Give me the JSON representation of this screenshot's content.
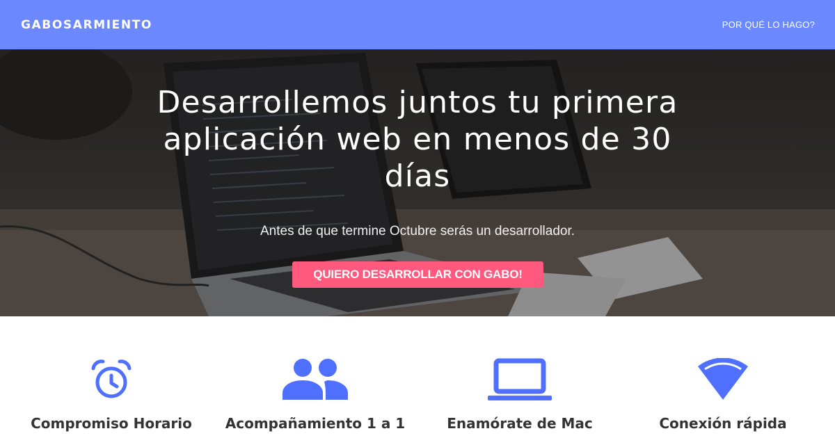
{
  "navbar": {
    "brand": "GABOSARMIENTO",
    "link": "POR QUÉ LO HAGO?",
    "background_color": "#6b88ff"
  },
  "hero": {
    "title": "Desarrollemos juntos tu primera aplicación web en menos de 30 días",
    "subtitle": "Antes de que termine Octubre serás un desarrollador.",
    "cta_label": "QUIERO DESARROLLAR CON GABO!",
    "cta_color": "#ff5a7e"
  },
  "features": {
    "icon_color": "#4f70ff",
    "items": [
      {
        "icon": "alarm-clock-icon",
        "label": "Compromiso Horario"
      },
      {
        "icon": "people-icon",
        "label": "Acompañamiento 1 a 1"
      },
      {
        "icon": "laptop-icon",
        "label": "Enamórate de Mac"
      },
      {
        "icon": "wifi-icon",
        "label": "Conexión rápida"
      }
    ]
  }
}
